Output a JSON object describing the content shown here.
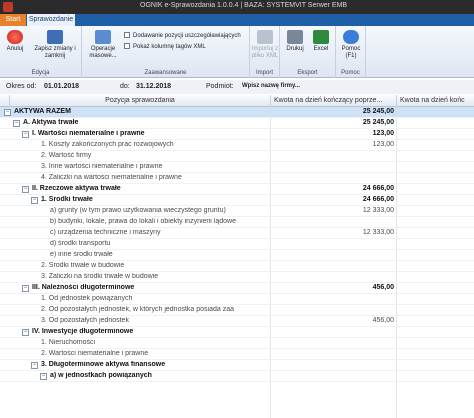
{
  "window": {
    "title": "OGNIK e-Sprawozdania 1.0.0.4 | BAZA: SYSTEMVIT Serwer EMB"
  },
  "tabs": {
    "file": "Start",
    "active": "Sprawozdanie"
  },
  "ribbon": {
    "edycja": {
      "label": "Edycja",
      "anuluj": "Anuluj",
      "zapisz": "Zapisz zmiany i zamknij"
    },
    "zaawansowane": {
      "label": "Zaawansowane",
      "operacje": "Operacje masowe...",
      "chk1": "Dodawanie pozycji uszczegóławiających",
      "chk2": "Pokaż kolumnę tagów XML"
    },
    "import": {
      "label": "Import",
      "importuj": "Importuj z pliku XML"
    },
    "eksport": {
      "label": "Eksport",
      "drukuj": "Drukuj",
      "excel": "Excel"
    },
    "pomoc": {
      "label": "Pomoc",
      "pomoc": "Pomoc (F1)"
    }
  },
  "filters": {
    "okres_od_label": "Okres od:",
    "okres_od": "01.01.2018",
    "do_label": "do:",
    "do": "31.12.2018",
    "podmiot_label": "Podmiot:",
    "podmiot": "Wpisz nazwę firmy..."
  },
  "grid": {
    "headers": [
      "Pozycja sprawozdania",
      "Kwota na dzień kończący poprze...",
      "Kwota na dzień końc"
    ],
    "rows": [
      {
        "label": "AKTYWA RAZEM",
        "value": "25 245,00",
        "indent": 0,
        "exp": "−",
        "cls": "lvl0 sel"
      },
      {
        "label": "A. Aktywa trwałe",
        "value": "25 245,00",
        "indent": 1,
        "exp": "−",
        "cls": "lvl1"
      },
      {
        "label": "I. Wartości niematerialne i prawne",
        "value": "123,00",
        "indent": 2,
        "exp": "−",
        "cls": "lvl2"
      },
      {
        "label": "1. Koszty zakończonych prac rozwojowych",
        "value": "123,00",
        "indent": 3,
        "exp": "",
        "cls": ""
      },
      {
        "label": "2. Wartość firmy",
        "value": "",
        "indent": 3,
        "exp": "",
        "cls": ""
      },
      {
        "label": "3. Inne wartości niematerialne i prawne",
        "value": "",
        "indent": 3,
        "exp": "",
        "cls": ""
      },
      {
        "label": "4. Zaliczki na wartości niematerialne i prawne",
        "value": "",
        "indent": 3,
        "exp": "",
        "cls": ""
      },
      {
        "label": "II. Rzeczowe aktywa trwałe",
        "value": "24 666,00",
        "indent": 2,
        "exp": "−",
        "cls": "lvl2"
      },
      {
        "label": "1. Środki trwałe",
        "value": "24 666,00",
        "indent": 3,
        "exp": "−",
        "cls": "lvl3"
      },
      {
        "label": "a) grunty (w tym prawo użytkowania wieczystego gruntu)",
        "value": "12 333,00",
        "indent": 4,
        "exp": "",
        "cls": ""
      },
      {
        "label": "b) budynki, lokale, prawa do lokali i obiekty inżynierii lądowe",
        "value": "",
        "indent": 4,
        "exp": "",
        "cls": ""
      },
      {
        "label": "c) urządzenia techniczne i maszyny",
        "value": "12 333,00",
        "indent": 4,
        "exp": "",
        "cls": ""
      },
      {
        "label": "d) środki transportu",
        "value": "",
        "indent": 4,
        "exp": "",
        "cls": ""
      },
      {
        "label": "e) inne środki trwałe",
        "value": "",
        "indent": 4,
        "exp": "",
        "cls": ""
      },
      {
        "label": "2. Środki trwałe w budowie",
        "value": "",
        "indent": 3,
        "exp": "",
        "cls": ""
      },
      {
        "label": "3. Zaliczki na środki trwałe w budowie",
        "value": "",
        "indent": 3,
        "exp": "",
        "cls": ""
      },
      {
        "label": "III. Należności długoterminowe",
        "value": "456,00",
        "indent": 2,
        "exp": "−",
        "cls": "lvl2"
      },
      {
        "label": "1. Od jednostek powiązanych",
        "value": "",
        "indent": 3,
        "exp": "",
        "cls": ""
      },
      {
        "label": "2. Od pozostałych jednostek, w których jednostka posiada zaa",
        "value": "",
        "indent": 3,
        "exp": "",
        "cls": ""
      },
      {
        "label": "3. Od pozostałych jednostek",
        "value": "456,00",
        "indent": 3,
        "exp": "",
        "cls": ""
      },
      {
        "label": "IV. Inwestycje długoterminowe",
        "value": "",
        "indent": 2,
        "exp": "−",
        "cls": "lvl2"
      },
      {
        "label": "1. Nieruchomości",
        "value": "",
        "indent": 3,
        "exp": "",
        "cls": ""
      },
      {
        "label": "2. Wartości niematerialne i prawne",
        "value": "",
        "indent": 3,
        "exp": "",
        "cls": ""
      },
      {
        "label": "3. Długoterminowe aktywa finansowe",
        "value": "",
        "indent": 3,
        "exp": "−",
        "cls": "lvl3"
      },
      {
        "label": "a) w jednostkach powiązanych",
        "value": "",
        "indent": 4,
        "exp": "−",
        "cls": "lvl3"
      }
    ]
  },
  "colors": {
    "accent_orange": "#e8812c",
    "ribbon_blue": "#1f5fa8",
    "selection": "#cfe1f7"
  }
}
